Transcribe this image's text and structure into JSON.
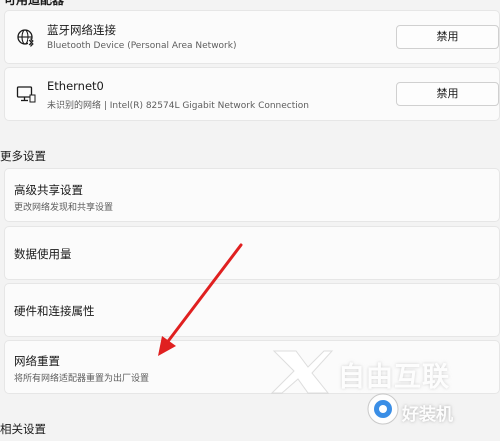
{
  "header_cut": "可用适配器",
  "devices": [
    {
      "icon": "bluetooth-network-icon",
      "name": "蓝牙网络连接",
      "description": "Bluetooth Device (Personal Area Network)",
      "button_label": "禁用"
    },
    {
      "icon": "ethernet-monitor-icon",
      "name": "Ethernet0",
      "description": "未识别的网络 | Intel(R) 82574L Gigabit Network Connection",
      "button_label": "禁用"
    }
  ],
  "more_settings": {
    "title": "更多设置",
    "items": [
      {
        "label": "高级共享设置",
        "description": "更改网络发现和共享设置"
      },
      {
        "label": "数据使用量"
      },
      {
        "label": "硬件和连接属性"
      },
      {
        "label": "网络重置",
        "description": "将所有网络适配器重置为出厂设置"
      }
    ]
  },
  "related_settings": {
    "title": "相关设置"
  },
  "watermark": {
    "text_main": "自由互联",
    "text_badge": "好装机"
  },
  "colors": {
    "background": "#f3f3f3",
    "card": "#fbfbfb",
    "arrow": "#e02020"
  }
}
